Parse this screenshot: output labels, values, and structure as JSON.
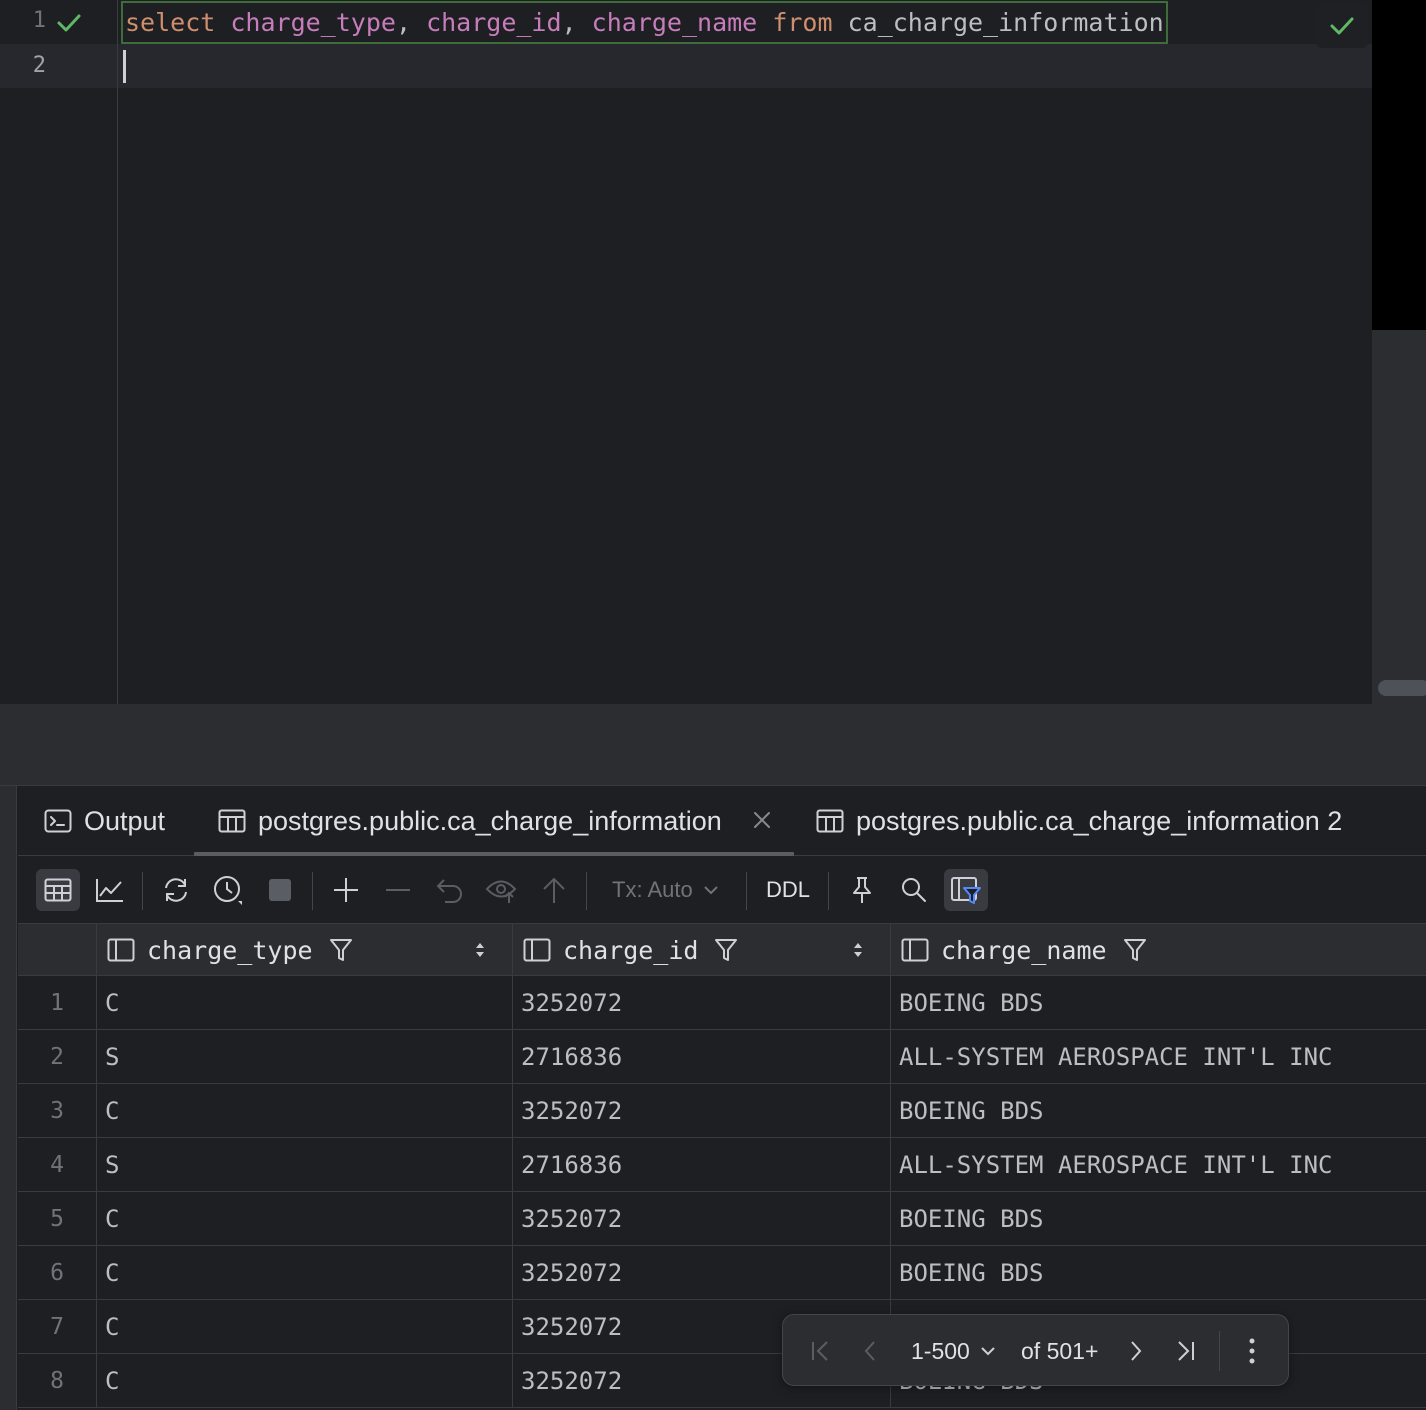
{
  "editor": {
    "line_numbers": [
      "1",
      "2"
    ],
    "query_tokens": {
      "select": "select",
      "col1": "charge_type",
      "comma1": ",",
      "col2": "charge_id",
      "comma2": ",",
      "col3": "charge_name",
      "from": "from",
      "table": "ca_charge_information"
    },
    "inspection_status": "ok"
  },
  "results": {
    "tabs": [
      {
        "label": "Output",
        "icon": "console-icon"
      },
      {
        "label": "postgres.public.ca_charge_information",
        "icon": "table-icon",
        "active": true,
        "closable": true
      },
      {
        "label": "postgres.public.ca_charge_information 2",
        "icon": "table-icon"
      }
    ],
    "toolbar": {
      "tx_mode": "Tx: Auto",
      "ddl_label": "DDL"
    },
    "grid": {
      "columns": [
        "charge_type",
        "charge_id",
        "charge_name"
      ],
      "rows": [
        {
          "n": "1",
          "cells": [
            "C",
            "3252072",
            "BOEING BDS"
          ]
        },
        {
          "n": "2",
          "cells": [
            "S",
            "2716836",
            "ALL-SYSTEM AEROSPACE INT'L INC"
          ]
        },
        {
          "n": "3",
          "cells": [
            "C",
            "3252072",
            "BOEING BDS"
          ]
        },
        {
          "n": "4",
          "cells": [
            "S",
            "2716836",
            "ALL-SYSTEM AEROSPACE INT'L INC"
          ]
        },
        {
          "n": "5",
          "cells": [
            "C",
            "3252072",
            "BOEING BDS"
          ]
        },
        {
          "n": "6",
          "cells": [
            "C",
            "3252072",
            "BOEING BDS"
          ]
        },
        {
          "n": "7",
          "cells": [
            "C",
            "3252072",
            ""
          ]
        },
        {
          "n": "8",
          "cells": [
            "C",
            "3252072",
            "BOEING BDS"
          ]
        }
      ]
    },
    "pager": {
      "range": "1-500",
      "total": "of 501+"
    }
  },
  "colors": {
    "keyword": "#cf8e6d",
    "column": "#c77dbb",
    "identifier": "#bcbec4",
    "success": "#5fb865",
    "background": "#1e1f22"
  }
}
